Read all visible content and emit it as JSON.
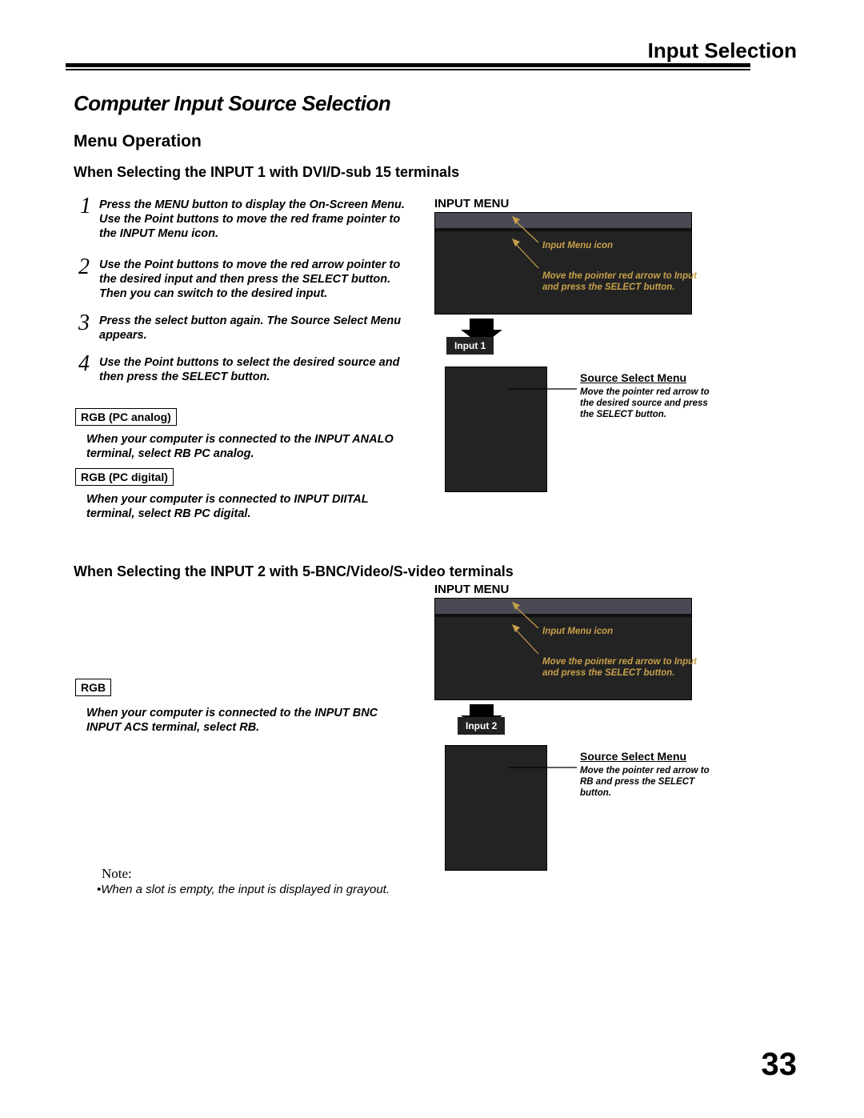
{
  "header": {
    "title": "Input Selection"
  },
  "section": {
    "title": "Computer Input Source Selection",
    "menu_op": "Menu Operation",
    "sub_a": "When Selecting the INPUT 1 with DVI/D-sub 15 terminals",
    "sub_b": "When Selecting the INPUT 2 with 5-BNC/Video/S-video terminals"
  },
  "steps": {
    "s1": {
      "num": "1",
      "text": "Press the MENU button to display the On-Screen Menu. Use the Point        buttons to move the red frame pointer to the INPUT Menu icon."
    },
    "s2": {
      "num": "2",
      "text": "Use the Point        buttons to move the red arrow pointer to the desired input and then press the SELECT button. Then you can switch to the desired input."
    },
    "s3": {
      "num": "3",
      "text": "Press the select button again. The Source Select Menu appears."
    },
    "s4": {
      "num": "4",
      "text": "Use the Point        buttons to select the desired source and then press the SELECT button."
    }
  },
  "boxes": {
    "rgb_analog": {
      "label": "RGB (PC analog)",
      "desc": "When your computer is connected to the INPUT  ANALO terminal, select RB PC analog."
    },
    "rgb_digital": {
      "label": "RGB (PC digital)",
      "desc": "When your computer is connected to INPUT  DIITAL terminal, select RB PC digital."
    },
    "rgb": {
      "label": "RGB",
      "desc": "When your computer is connected to the INPUT   BNC INPUT ACS terminal, select RB."
    }
  },
  "rcol": {
    "menu_label": "INPUT MENU",
    "input1_chip": "Input 1",
    "input2_chip": "Input 2",
    "src_label": "Source Select Menu",
    "ptr_icon": "Input Menu icon",
    "ptr_move": "Move the pointer red arrow to Input and press the SELECT button.",
    "ptr_src1": "Move the pointer red arrow to the desired source and press the SELECT button.",
    "ptr_src2": "Move the pointer red arrow to RB and press the SELECT button."
  },
  "note": {
    "hd": "Note:",
    "txt": "•When a slot is empty, the input is displayed in grayout."
  },
  "page": "33"
}
